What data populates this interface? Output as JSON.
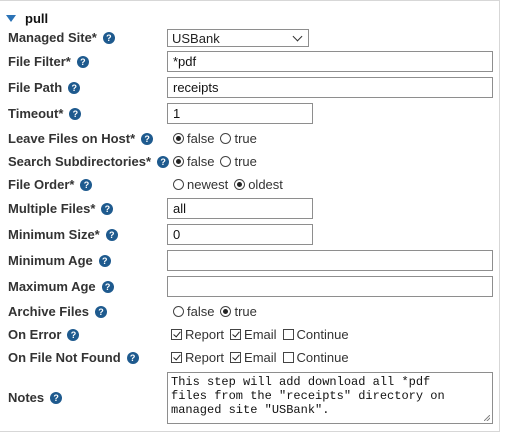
{
  "section": {
    "title": "pull"
  },
  "fields": {
    "managed_site": {
      "label": "Managed Site*",
      "value": "USBank"
    },
    "file_filter": {
      "label": "File Filter*",
      "value": "*pdf"
    },
    "file_path": {
      "label": "File Path",
      "value": "receipts"
    },
    "timeout": {
      "label": "Timeout*",
      "value": "1"
    },
    "leave_files": {
      "label": "Leave Files on Host*",
      "opt1": "false",
      "opt2": "true",
      "selected": "false"
    },
    "search_subdirs": {
      "label": "Search Subdirectories*",
      "opt1": "false",
      "opt2": "true",
      "selected": "false"
    },
    "file_order": {
      "label": "File Order*",
      "opt1": "newest",
      "opt2": "oldest",
      "selected": "oldest"
    },
    "multiple_files": {
      "label": "Multiple Files*",
      "value": "all"
    },
    "minimum_size": {
      "label": "Minimum Size*",
      "value": "0"
    },
    "minimum_age": {
      "label": "Minimum Age",
      "value": ""
    },
    "maximum_age": {
      "label": "Maximum Age",
      "value": ""
    },
    "archive_files": {
      "label": "Archive Files",
      "opt1": "false",
      "opt2": "true",
      "selected": "true"
    },
    "on_error": {
      "label": "On Error",
      "report": "Report",
      "email": "Email",
      "continue": "Continue",
      "report_checked": true,
      "email_checked": true,
      "continue_checked": false
    },
    "on_file_not_found": {
      "label": "On File Not Found",
      "report": "Report",
      "email": "Email",
      "continue": "Continue",
      "report_checked": true,
      "email_checked": true,
      "continue_checked": false
    },
    "notes": {
      "label": "Notes",
      "value": "This step will add download all *pdf\nfiles from the \"receipts\" directory on\nmanaged site \"USBank\"."
    }
  },
  "help_icon": "?",
  "icons": {
    "section_toggle": "caret-down-icon",
    "help": "help-circle-icon",
    "dropdown": "chevron-down-icon"
  },
  "colors": {
    "accent": "#2b73b6",
    "help_icon": "#1e5a8e"
  }
}
